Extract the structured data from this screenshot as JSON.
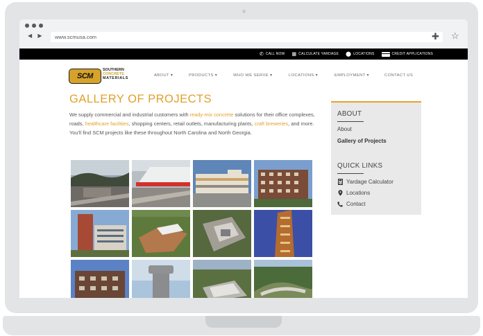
{
  "browser": {
    "url": "www.scmusa.com",
    "nav_arrows": "◀ ▶",
    "plus_icon": "plus-icon",
    "star_icon": "star-icon"
  },
  "topbar": {
    "items": [
      {
        "label": "CALL NOW",
        "icon": "phone-icon"
      },
      {
        "label": "CALCULATE YARDAGE",
        "icon": "calculator-icon"
      },
      {
        "label": "LOCATIONS",
        "icon": "map-pin-icon"
      },
      {
        "label": "CREDIT APPLICATIONS",
        "icon": "credit-card-icon"
      }
    ]
  },
  "logo": {
    "mark": "SCM",
    "line1": "SOUTHERN",
    "line2": "CONCRETE",
    "line3": "MATERIALS"
  },
  "main_nav": [
    {
      "label": "ABOUT ▾"
    },
    {
      "label": "PRODUCTS ▾"
    },
    {
      "label": "WHO WE SERVE ▾"
    },
    {
      "label": "LOCATIONS ▾"
    },
    {
      "label": "EMPLOYMENT ▾"
    },
    {
      "label": "CONTACT US"
    }
  ],
  "page": {
    "title": "GALLERY OF PROJECTS",
    "intro_p1": "We supply commercial and industrial customers with ",
    "intro_link1": "ready-mix concrete",
    "intro_p2": " solutions for their office complexes, roads, ",
    "intro_link2": "healthcare facilities",
    "intro_p3": ", shopping centers, retail outlets, manufacturing plants, ",
    "intro_link3": "craft breweries",
    "intro_p4": ", and more. You'll find SCM projects like these throughout North Carolina and North Georgia."
  },
  "sidebar": {
    "about_heading": "ABOUT",
    "about_links": [
      {
        "label": "About"
      },
      {
        "label": "Gallery of Projects"
      }
    ],
    "quick_heading": "QUICK LINKS",
    "quick_links": [
      {
        "label": "Yardage Calculator",
        "icon": "calculator-icon"
      },
      {
        "label": "Locations",
        "icon": "map-pin-icon"
      },
      {
        "label": "Contact",
        "icon": "phone-icon"
      }
    ]
  },
  "colors": {
    "accent": "#dfa02b",
    "topbar": "#000000",
    "sidebar_bg": "#e9e9e9"
  }
}
